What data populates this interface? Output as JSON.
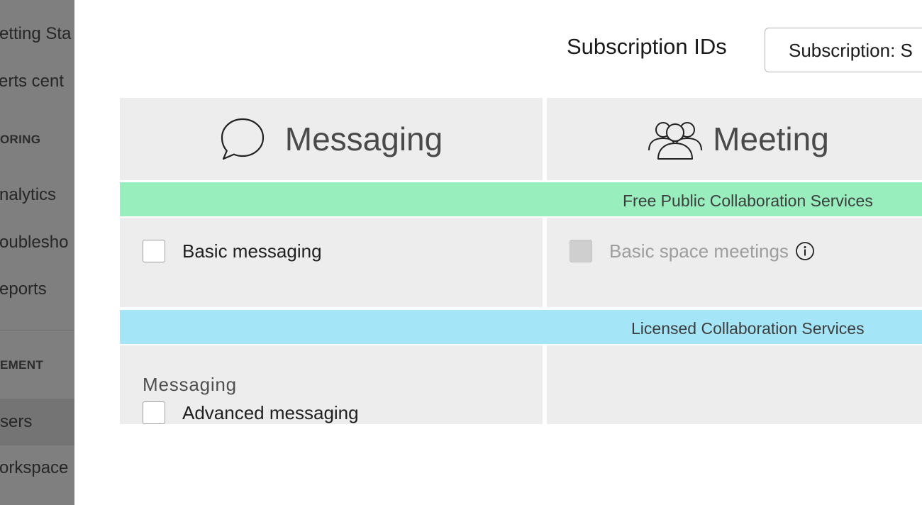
{
  "sidebar": {
    "items": [
      {
        "label": "etting Sta"
      },
      {
        "label": "erts cent"
      },
      {
        "label": "nalytics"
      },
      {
        "label": "oublesho"
      },
      {
        "label": "eports"
      },
      {
        "label": "sers"
      },
      {
        "label": "orkspace"
      }
    ],
    "sections": [
      {
        "label": "ORING"
      },
      {
        "label": "EMENT"
      }
    ]
  },
  "header": {
    "subscription_label": "Subscription IDs",
    "subscription_value": "Subscription: S"
  },
  "columns": [
    {
      "title": "Messaging",
      "icon": "chat-bubble-icon"
    },
    {
      "title": "Meeting",
      "icon": "people-group-icon"
    }
  ],
  "bands": {
    "free": {
      "label": "Free Public Collaboration Services",
      "color": "#98efbd"
    },
    "licensed": {
      "label": "Licensed Collaboration Services",
      "color": "#a4e6f8"
    }
  },
  "free_services": {
    "basic_messaging": {
      "label": "Basic messaging",
      "checked": false
    },
    "basic_space_meetings": {
      "label": "Basic space meetings",
      "checked": false,
      "disabled": true,
      "icon": "info-icon"
    }
  },
  "licensed_services": {
    "messaging_heading": "Messaging",
    "advanced_messaging": {
      "label": "Advanced messaging",
      "checked": false
    }
  }
}
